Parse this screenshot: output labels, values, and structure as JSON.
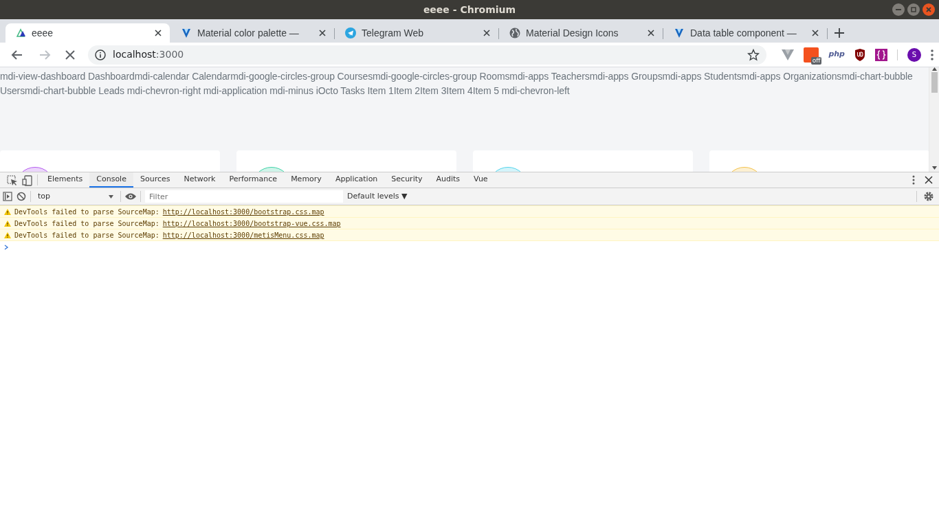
{
  "window": {
    "title": "eeee - Chromium"
  },
  "tabs": [
    {
      "title": "eeee",
      "kind": "vue",
      "selected": true
    },
    {
      "title": "Material color palette —",
      "kind": "vuetify",
      "selected": false
    },
    {
      "title": "Telegram Web",
      "kind": "telegram",
      "selected": false
    },
    {
      "title": "Material Design Icons",
      "kind": "globe",
      "selected": false
    },
    {
      "title": "Data table component —",
      "kind": "vuetify",
      "selected": false
    }
  ],
  "address_bar": {
    "host": "localhost",
    "port": ":3000"
  },
  "extensions": [
    {
      "kind": "v"
    },
    {
      "kind": "off",
      "label": "off"
    },
    {
      "kind": "php",
      "label": "php"
    },
    {
      "kind": "shield"
    },
    {
      "kind": "braces"
    }
  ],
  "profile": {
    "initial": "S"
  },
  "page": {
    "nav_text": "mdi-view-dashboard Dashboardmdi-calendar Calendarmdi-google-circles-group Coursesmdi-google-circles-group Roomsmdi-apps Teachersmdi-apps Groupsmdi-apps Studentsmdi-apps Organizationsmdi-chart-bubble Usersmdi-chart-bubble Leads mdi-chevron-right mdi-application mdi-minus iOcto Tasks Item 1Item 2Item 3Item 4Item 5 mdi-chevron-left",
    "cards": [
      {
        "color": "#b55cf0"
      },
      {
        "color": "#3fd3a8"
      },
      {
        "color": "#52d4ec"
      },
      {
        "color": "#f4c24a"
      }
    ]
  },
  "devtools": {
    "tabs": [
      {
        "label": "Elements",
        "selected": false
      },
      {
        "label": "Console",
        "selected": true
      },
      {
        "label": "Sources",
        "selected": false
      },
      {
        "label": "Network",
        "selected": false
      },
      {
        "label": "Performance",
        "selected": false
      },
      {
        "label": "Memory",
        "selected": false
      },
      {
        "label": "Application",
        "selected": false
      },
      {
        "label": "Security",
        "selected": false
      },
      {
        "label": "Audits",
        "selected": false
      },
      {
        "label": "Vue",
        "selected": false
      }
    ],
    "context": "top",
    "filter_placeholder": "Filter",
    "levels": "Default levels ▼",
    "messages": [
      {
        "text": "DevTools failed to parse SourceMap:",
        "link": "http://localhost:3000/bootstrap.css.map"
      },
      {
        "text": "DevTools failed to parse SourceMap:",
        "link": "http://localhost:3000/bootstrap-vue.css.map"
      },
      {
        "text": "DevTools failed to parse SourceMap:",
        "link": "http://localhost:3000/metisMenu.css.map"
      }
    ]
  }
}
